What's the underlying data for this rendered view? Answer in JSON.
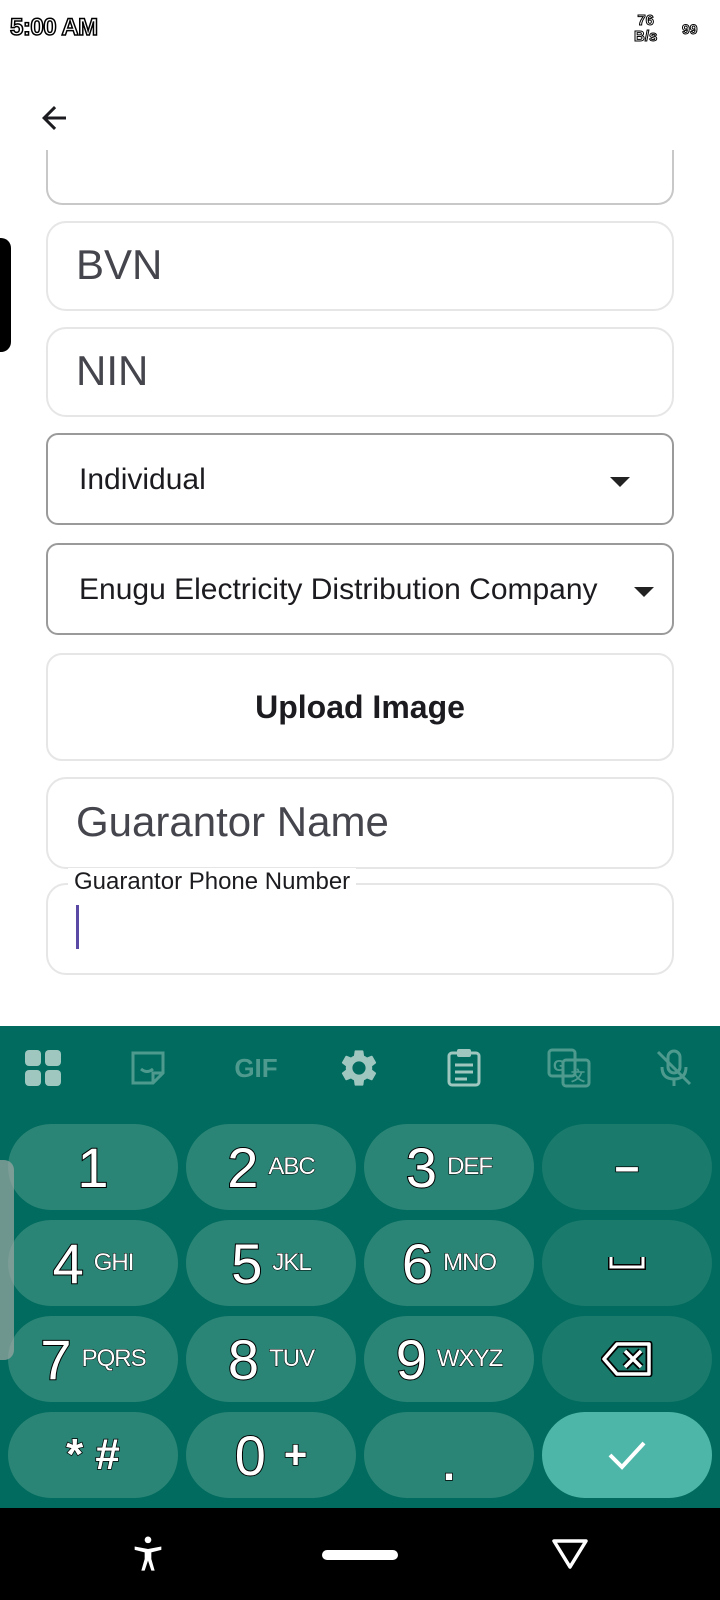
{
  "status_bar": {
    "time": "5:00 AM",
    "speed_value": "76",
    "speed_unit": "B/s",
    "battery": "99"
  },
  "form": {
    "bvn_placeholder": "BVN",
    "nin_placeholder": "NIN",
    "customer_type": "Individual",
    "disco": "Enugu Electricity Distribution Company",
    "upload_label": "Upload Image",
    "guarantor_name_placeholder": "Guarantor Name",
    "guarantor_phone_label": "Guarantor Phone Number",
    "guarantor_phone_value": ""
  },
  "keyboard": {
    "toolbar": [
      "apps-icon",
      "sticker-icon",
      "gif-icon",
      "settings-icon",
      "clipboard-icon",
      "translate-icon",
      "mic-off-icon"
    ],
    "gif_label": "GIF",
    "keys": [
      {
        "main": "1",
        "sub": ""
      },
      {
        "main": "2",
        "sub": "ABC"
      },
      {
        "main": "3",
        "sub": "DEF"
      },
      {
        "main": "–",
        "sub": ""
      },
      {
        "main": "4",
        "sub": "GHI"
      },
      {
        "main": "5",
        "sub": "JKL"
      },
      {
        "main": "6",
        "sub": "MNO"
      },
      {
        "main": "␣",
        "sub": ""
      },
      {
        "main": "7",
        "sub": "PQRS"
      },
      {
        "main": "8",
        "sub": "TUV"
      },
      {
        "main": "9",
        "sub": "WXYZ"
      },
      {
        "main": "⌫",
        "sub": ""
      },
      {
        "main": "* #",
        "sub": ""
      },
      {
        "main": "0",
        "sub": "+"
      },
      {
        "main": ".",
        "sub": ""
      },
      {
        "main": "✓",
        "sub": ""
      }
    ]
  },
  "colors": {
    "keyboard_bg": "#006b5e",
    "key_bg": "#2a8576",
    "enter_bg": "#4db6a8",
    "cursor": "#5b4aa5"
  }
}
